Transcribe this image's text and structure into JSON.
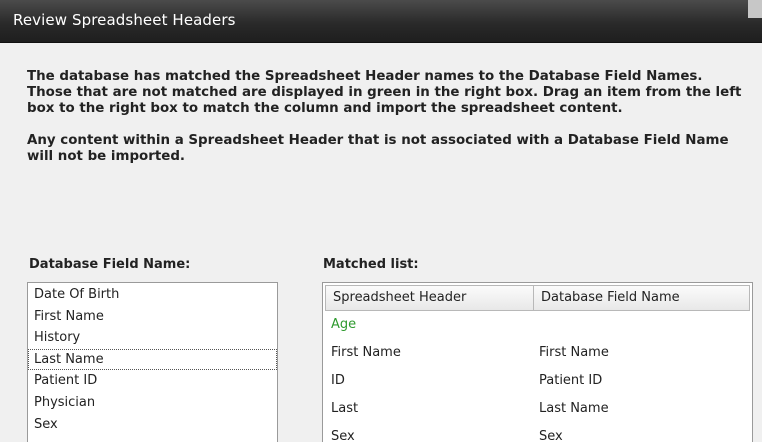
{
  "window": {
    "title": "Review Spreadsheet Headers"
  },
  "instructions": {
    "paragraph1": "The database has matched the Spreadsheet Header names to the Database Field Names.  Those that are not matched are displayed in green in the right box.  Drag an item from the left box to the right box to match the column and import the spreadsheet content.",
    "paragraph2": "Any content within a Spreadsheet Header that is not associated with a Database Field Name will not be imported."
  },
  "database_fields": {
    "label": "Database Field Name:",
    "items": [
      {
        "label": "Date Of Birth"
      },
      {
        "label": "First Name"
      },
      {
        "label": "History"
      },
      {
        "label": "Last Name",
        "focused": true
      },
      {
        "label": "Patient ID"
      },
      {
        "label": "Physician"
      },
      {
        "label": "Sex"
      }
    ]
  },
  "matched_list": {
    "label": "Matched list:",
    "columns": [
      "Spreadsheet Header",
      "Database Field Name"
    ],
    "rows": [
      {
        "spreadsheet_header": "Age",
        "database_field": "",
        "matched": false
      },
      {
        "spreadsheet_header": "First Name",
        "database_field": "First Name",
        "matched": true
      },
      {
        "spreadsheet_header": "ID",
        "database_field": "Patient ID",
        "matched": true
      },
      {
        "spreadsheet_header": "Last",
        "database_field": "Last Name",
        "matched": true
      },
      {
        "spreadsheet_header": "Sex",
        "database_field": "Sex",
        "matched": true
      }
    ],
    "unmatched_color": "#2e9a2e"
  }
}
